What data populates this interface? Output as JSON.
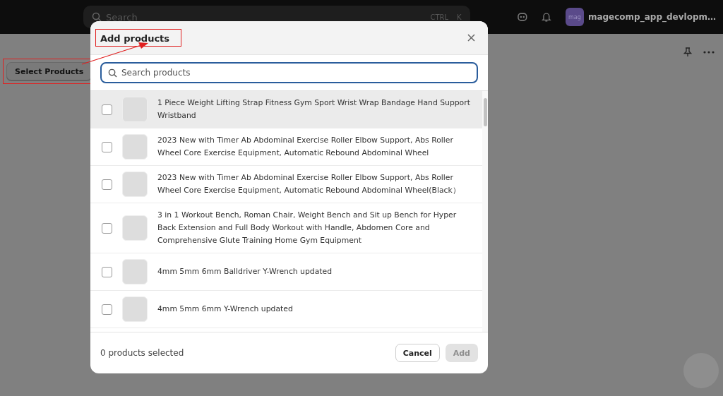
{
  "top_bar": {
    "search": {
      "placeholder": "Search",
      "shortcut": [
        "CTRL",
        "K"
      ]
    },
    "store": {
      "avatar": "mag",
      "name": "magecomp_app_devlopm…"
    }
  },
  "page": {
    "select_button": "Select Products"
  },
  "modal": {
    "title": "Add products",
    "search": {
      "placeholder": "Search products"
    },
    "products": [
      {
        "name": "1 Piece Weight Lifting Strap Fitness Gym Sport Wrist Wrap Bandage Hand Support Wristband",
        "checked": false,
        "hovered": true
      },
      {
        "name": "2023 New with Timer Ab Abdominal Exercise Roller Elbow Support, Abs Roller Wheel Core Exercise Equipment, Automatic Rebound Abdominal Wheel",
        "checked": false,
        "hovered": false
      },
      {
        "name": "2023 New with Timer Ab Abdominal Exercise Roller Elbow Support, Abs Roller Wheel Core Exercise Equipment, Automatic Rebound Abdominal Wheel(Black）",
        "checked": false,
        "hovered": false
      },
      {
        "name": "3 in 1 Workout Bench, Roman Chair, Weight Bench and Sit up Bench for Hyper Back Extension and Full Body Workout with Handle, Abdomen Core and Comprehensive Glute Training Home Gym Equipment",
        "checked": false,
        "hovered": false
      },
      {
        "name": "4mm 5mm 6mm Balldriver Y-Wrench updated",
        "checked": false,
        "hovered": false
      },
      {
        "name": "4mm 5mm 6mm Y-Wrench updated",
        "checked": false,
        "hovered": false
      }
    ],
    "selected_count": "0 products selected",
    "cancel": "Cancel",
    "add": {
      "label": "Add",
      "disabled": true
    }
  }
}
